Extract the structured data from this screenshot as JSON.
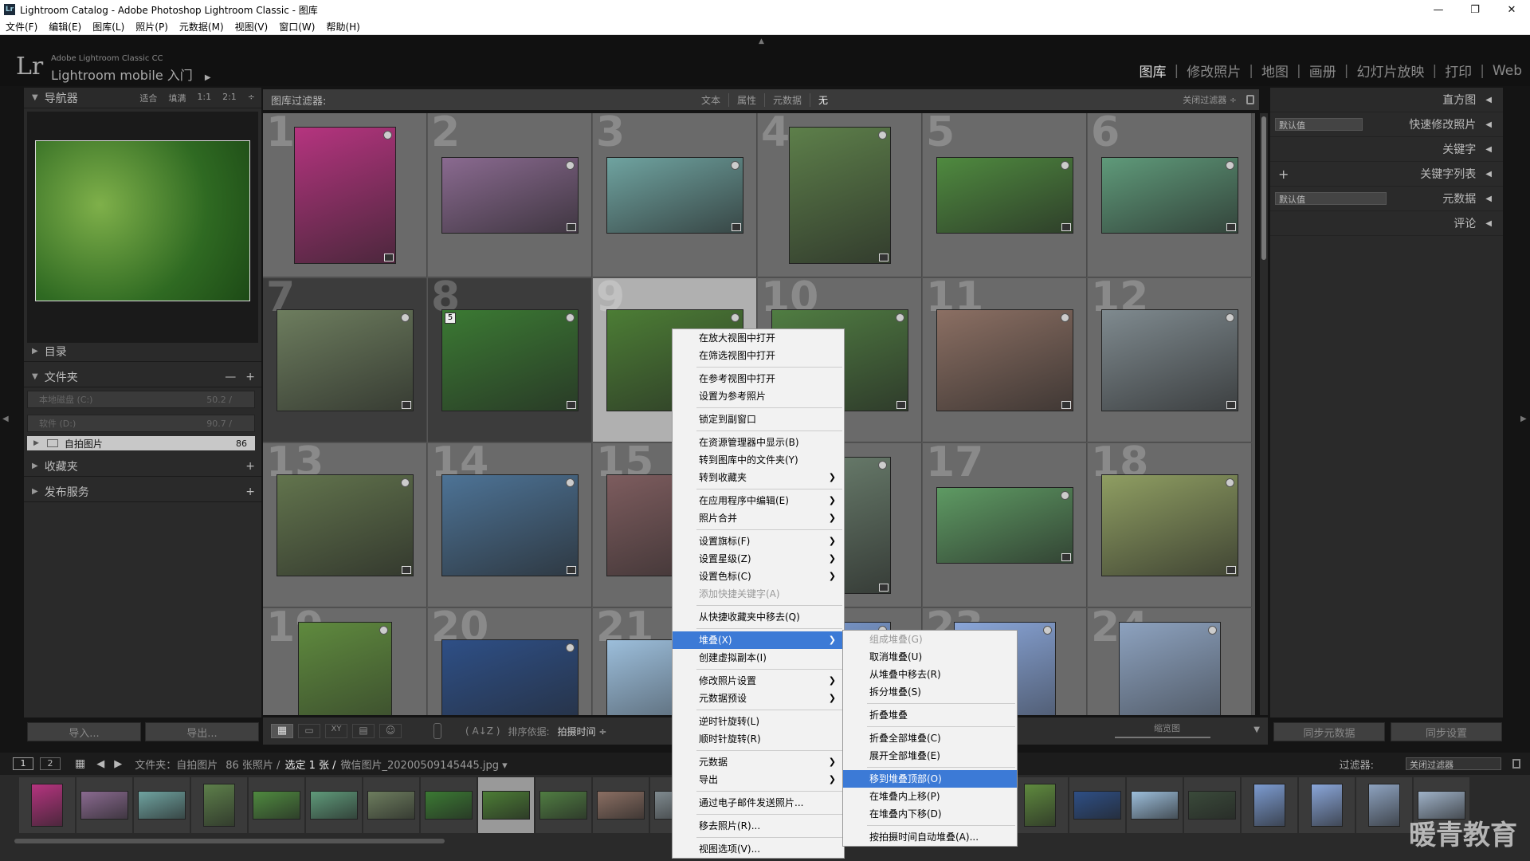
{
  "window": {
    "title": "Lightroom Catalog - Adobe Photoshop Lightroom Classic - 图库",
    "minimize": "—",
    "restore": "❐",
    "close": "✕"
  },
  "menu": [
    "文件(F)",
    "编辑(E)",
    "图库(L)",
    "照片(P)",
    "元数据(M)",
    "视图(V)",
    "窗口(W)",
    "帮助(H)"
  ],
  "identity": {
    "logo": "Lr",
    "product": "Adobe Lightroom Classic CC",
    "plate": "Lightroom mobile 入门",
    "plate_arrow": "▶"
  },
  "modules": [
    {
      "label": "图库",
      "active": true
    },
    {
      "label": "修改照片",
      "active": false
    },
    {
      "label": "地图",
      "active": false
    },
    {
      "label": "画册",
      "active": false
    },
    {
      "label": "幻灯片放映",
      "active": false
    },
    {
      "label": "打印",
      "active": false
    },
    {
      "label": "Web",
      "active": false
    }
  ],
  "left": {
    "navigator": {
      "title": "导航器",
      "zoom": [
        "适合",
        "填满",
        "1:1",
        "2:1"
      ]
    },
    "catalog": "目录",
    "folders": {
      "title": "文件夹",
      "minus": "—",
      "plus": "+",
      "volumes": [
        {
          "name": "本地磁盘 (C:)",
          "size": "50.2 /"
        },
        {
          "name": "软件 (D:)",
          "size": "90.7 /"
        }
      ],
      "folder": {
        "name": "自拍图片",
        "count": "86"
      }
    },
    "collections": "收藏夹",
    "publish": "发布服务",
    "import": "导入...",
    "export": "导出..."
  },
  "filterbar": {
    "label": "图库过滤器:",
    "tabs": [
      "文本",
      "属性",
      "元数据",
      "无"
    ],
    "close": "关闭过滤器 ÷"
  },
  "right": {
    "histogram": "直方图",
    "quick": {
      "preset": "默认值",
      "title": "快速修改照片"
    },
    "keywording": "关键字",
    "keywordlist": {
      "plus": "+",
      "title": "关键字列表"
    },
    "metadata": {
      "preset": "默认值",
      "title": "元数据"
    },
    "comments": "评论",
    "sync_meta": "同步元数据",
    "sync_settings": "同步设置"
  },
  "grid": {
    "cells": [
      {
        "n": "1",
        "w": 128,
        "h": 172,
        "c": "#b5347f"
      },
      {
        "n": "2",
        "w": 172,
        "h": 96,
        "c": "#8a6a90"
      },
      {
        "n": "3",
        "w": 172,
        "h": 96,
        "c": "#6fa3a0"
      },
      {
        "n": "4",
        "w": 128,
        "h": 172,
        "c": "#5d7f4a"
      },
      {
        "n": "5",
        "w": 172,
        "h": 96,
        "c": "#4f8a3f"
      },
      {
        "n": "6",
        "w": 172,
        "h": 96,
        "c": "#5f9a7a"
      },
      {
        "n": "7",
        "w": 172,
        "h": 128,
        "c": "#6d7d5e"
      },
      {
        "n": "8",
        "w": 172,
        "h": 128,
        "c": "#3b7a33",
        "stack": "5"
      },
      {
        "n": "9",
        "w": 172,
        "h": 128,
        "c": "#4c7d35"
      },
      {
        "n": "10",
        "w": 172,
        "h": 128,
        "c": "#507d42"
      },
      {
        "n": "11",
        "w": 172,
        "h": 128,
        "c": "#8b6f63"
      },
      {
        "n": "12",
        "w": 172,
        "h": 128,
        "c": "#7f8a8f"
      },
      {
        "n": "13",
        "w": 172,
        "h": 128,
        "c": "#62744d"
      },
      {
        "n": "14",
        "w": 172,
        "h": 128,
        "c": "#4d7396"
      },
      {
        "n": "15",
        "w": 172,
        "h": 128,
        "c": "#7d5c5e"
      },
      {
        "n": "16",
        "w": 128,
        "h": 172,
        "c": "#6b7f6e"
      },
      {
        "n": "17",
        "w": 172,
        "h": 96,
        "c": "#5e9a63"
      },
      {
        "n": "18",
        "w": 172,
        "h": 128,
        "c": "#8f9e62"
      },
      {
        "n": "19",
        "w": 118,
        "h": 172,
        "c": "#5f8a3e"
      },
      {
        "n": "20",
        "w": 172,
        "h": 128,
        "c": "#2e4f86"
      },
      {
        "n": "21",
        "w": 172,
        "h": 128,
        "c": "#9cbedb"
      },
      {
        "n": "22",
        "w": 128,
        "h": 172,
        "c": "#7c9bd0"
      },
      {
        "n": "23",
        "w": 128,
        "h": 172,
        "c": "#8aa6d9"
      },
      {
        "n": "24",
        "w": 128,
        "h": 172,
        "c": "#8da2bf"
      }
    ]
  },
  "toolbar": {
    "sort_label": "排序依据:",
    "sort_value": "拍摄时间 ÷",
    "thumb_label": "缩览图",
    "views": [
      "▦",
      "▭",
      "XY",
      "▤",
      "☺"
    ]
  },
  "status": {
    "pages": [
      "1",
      "2"
    ],
    "folder_label": "文件夹：自拍图片",
    "count": "86 张照片 /",
    "selected": "选定 1 张 /",
    "file": "微信图片_20200509145445.jpg ▾",
    "filter_label": "过滤器:",
    "filter_value": "关闭过滤器"
  },
  "filmstrip": {
    "colors": [
      "#b5347f",
      "#8a6a90",
      "#6fa3a0",
      "#5d7f4a",
      "#4f8a3f",
      "#5f9a7a",
      "#6d7d5e",
      "#3b7a33",
      "#4c7d35",
      "#507d42",
      "#8b6f63",
      "#7f8a8f",
      "#5f8a3e",
      "#2e4f86",
      "#9cbedb",
      "#3a4a3a",
      "#7c9bd0",
      "#8aa6d9",
      "#8da2bf",
      "#9fb2c8"
    ]
  },
  "context_menu": [
    {
      "label": "在放大视图中打开"
    },
    {
      "label": "在筛选视图中打开"
    },
    {
      "sep": true
    },
    {
      "label": "在参考视图中打开"
    },
    {
      "label": "设置为参考照片"
    },
    {
      "sep": true
    },
    {
      "label": "锁定到副窗口"
    },
    {
      "sep": true
    },
    {
      "label": "在资源管理器中显示(B)"
    },
    {
      "label": "转到图库中的文件夹(Y)"
    },
    {
      "label": "转到收藏夹",
      "sub": true
    },
    {
      "sep": true
    },
    {
      "label": "在应用程序中编辑(E)",
      "sub": true
    },
    {
      "label": "照片合并",
      "sub": true
    },
    {
      "sep": true
    },
    {
      "label": "设置旗标(F)",
      "sub": true
    },
    {
      "label": "设置星级(Z)",
      "sub": true
    },
    {
      "label": "设置色标(C)",
      "sub": true
    },
    {
      "label": "添加快捷关键字(A)",
      "dis": true
    },
    {
      "sep": true
    },
    {
      "label": "从快捷收藏夹中移去(Q)"
    },
    {
      "sep": true
    },
    {
      "label": "堆叠(X)",
      "sub": true,
      "hi": true
    },
    {
      "label": "创建虚拟副本(I)"
    },
    {
      "sep": true
    },
    {
      "label": "修改照片设置",
      "sub": true
    },
    {
      "label": "元数据预设",
      "sub": true
    },
    {
      "sep": true
    },
    {
      "label": "逆时针旋转(L)"
    },
    {
      "label": "顺时针旋转(R)"
    },
    {
      "sep": true
    },
    {
      "label": "元数据",
      "sub": true
    },
    {
      "label": "导出",
      "sub": true
    },
    {
      "sep": true
    },
    {
      "label": "通过电子邮件发送照片..."
    },
    {
      "sep": true
    },
    {
      "label": "移去照片(R)..."
    },
    {
      "sep": true
    },
    {
      "label": "视图选项(V)..."
    }
  ],
  "submenu": [
    {
      "label": "组成堆叠(G)",
      "dis": true
    },
    {
      "label": "取消堆叠(U)"
    },
    {
      "label": "从堆叠中移去(R)"
    },
    {
      "label": "拆分堆叠(S)"
    },
    {
      "sep": true
    },
    {
      "label": "折叠堆叠"
    },
    {
      "sep": true
    },
    {
      "label": "折叠全部堆叠(C)"
    },
    {
      "label": "展开全部堆叠(E)"
    },
    {
      "sep": true
    },
    {
      "label": "移到堆叠顶部(O)",
      "hi": true
    },
    {
      "label": "在堆叠内上移(P)"
    },
    {
      "label": "在堆叠内下移(D)"
    },
    {
      "sep": true
    },
    {
      "label": "按拍摄时间自动堆叠(A)..."
    }
  ],
  "watermark": "暖青教育",
  "arrow_sub": "❯",
  "arrow_side_left": "◀",
  "arrow_side_right": "▶"
}
